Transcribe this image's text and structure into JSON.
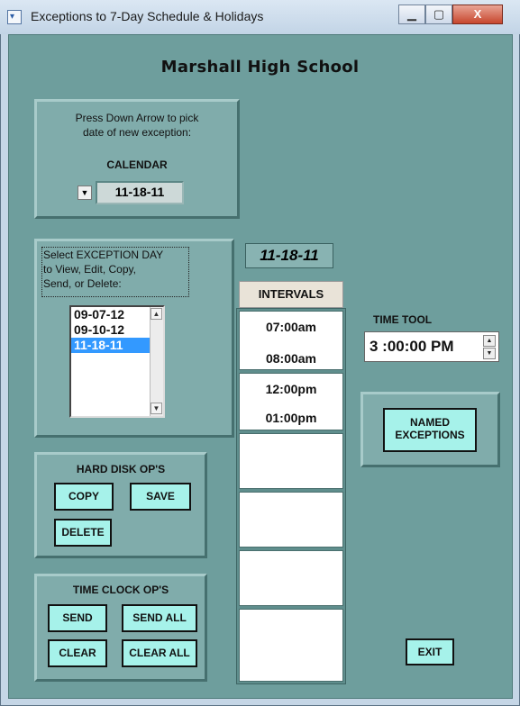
{
  "window": {
    "title": "Exceptions to 7-Day Schedule & Holidays",
    "minimize": "▁",
    "maximize": "▢",
    "close": "X"
  },
  "school": "Marshall High School",
  "calendar_panel": {
    "instruction_line1": "Press Down Arrow to pick",
    "instruction_line2": "date of new exception:",
    "label": "CALENDAR",
    "value": "11-18-11"
  },
  "exception_panel": {
    "instruction_line1": "Select EXCEPTION DAY",
    "instruction_line2": "to View, Edit, Copy,",
    "instruction_line3": "Send, or Delete:",
    "items": [
      "09-07-12",
      "09-10-12",
      "11-18-11"
    ],
    "selected_index": 2
  },
  "hard_disk": {
    "title": "HARD DISK OP'S",
    "copy": "COPY",
    "save": "SAVE",
    "delete": "DELETE"
  },
  "time_clock": {
    "title": "TIME CLOCK OP'S",
    "send": "SEND",
    "send_all": "SEND ALL",
    "clear": "CLEAR",
    "clear_all": "CLEAR ALL"
  },
  "intervals": {
    "date": "11-18-11",
    "header": "INTERVALS",
    "boxes": [
      {
        "start": "07:00am",
        "end": "08:00am"
      },
      {
        "start": "12:00pm",
        "end": "01:00pm"
      },
      {
        "start": "",
        "end": ""
      },
      {
        "start": "",
        "end": ""
      },
      {
        "start": "",
        "end": ""
      },
      {
        "start": "",
        "end": ""
      }
    ]
  },
  "time_tool": {
    "label": "TIME TOOL",
    "value": "3 :00:00 PM"
  },
  "named_exceptions": {
    "line1": "NAMED",
    "line2": "EXCEPTIONS"
  },
  "exit": "EXIT",
  "colors": {
    "background": "#6e9e9d",
    "panel": "#80acab",
    "button": "#a6f2ea",
    "selection": "#3399ff"
  }
}
